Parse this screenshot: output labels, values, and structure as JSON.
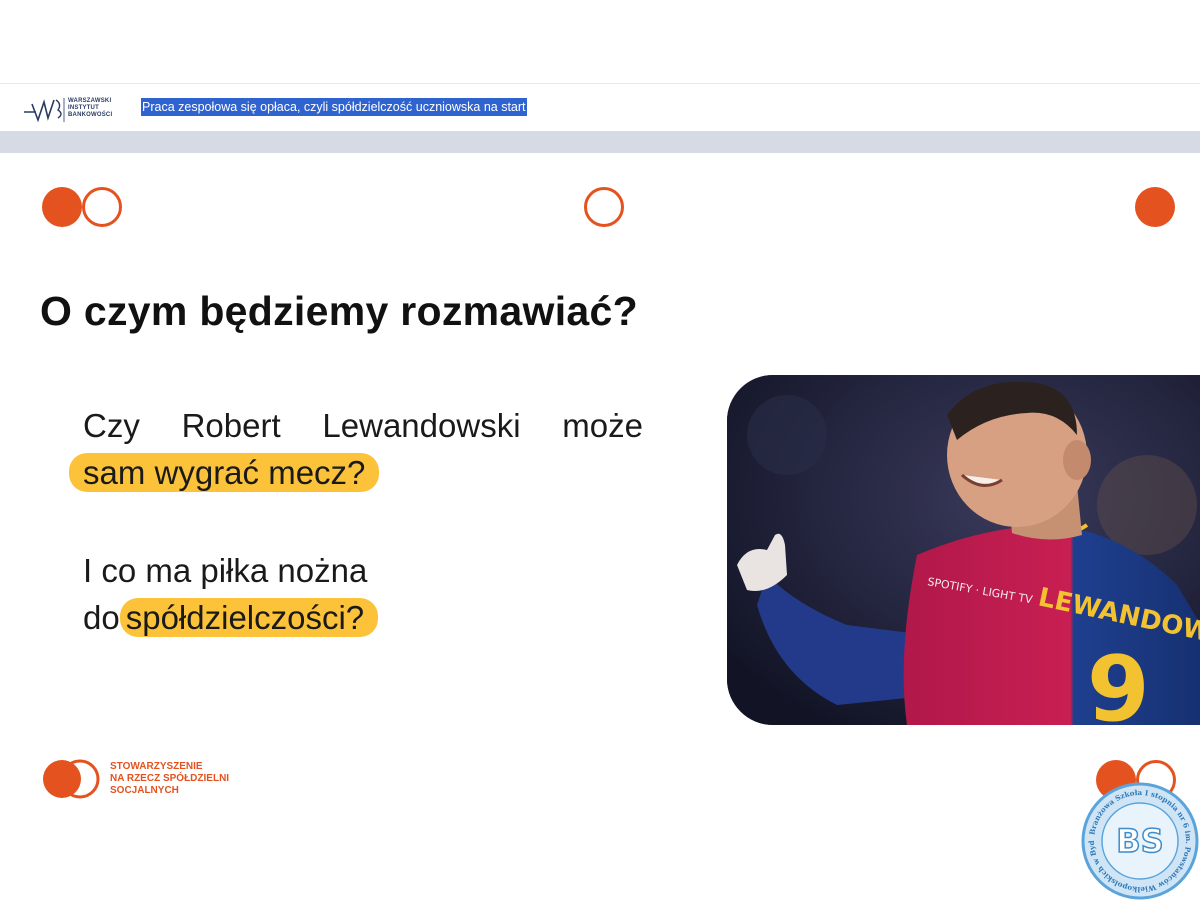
{
  "header": {
    "logo_lines": [
      "WARSZAWSKI",
      "INSTYTUT",
      "BANKOWOŚCI"
    ],
    "course_title": "Praca zespołowa się opłaca, czyli spółdzielczość uczniowska na start"
  },
  "slide": {
    "heading": "O czym będziemy rozmawiać?",
    "question1_line1": "Czy Robert Lewandowski może",
    "question1_highlight": "sam wygrać mecz?",
    "question2_line1": "I co ma piłka nożna",
    "question2_prefix": "do",
    "question2_highlight": "spółdzielczości?",
    "photo": {
      "alt": "Robert Lewandowski celebrating",
      "jersey_name": "LEWANDOWSKI",
      "jersey_number": "9",
      "sponsor": "SPOTIFY · LIGHT TV"
    },
    "footer_logo_lines": [
      "STOWARZYSZENIE",
      "NA RZECZ SPÓŁDZIELNI",
      "SOCJALNYCH"
    ]
  },
  "stamp": {
    "letters": "BS",
    "ring_text": "Branżowa Szkoła I stopnia nr 6 im. Powstańców Wielkopolskich w Bydgoszczy"
  },
  "colors": {
    "accent_orange": "#e4531f",
    "highlight_yellow": "#fcc33a",
    "selection_blue": "#2f63d0",
    "nav_gray": "#d5dae5"
  }
}
